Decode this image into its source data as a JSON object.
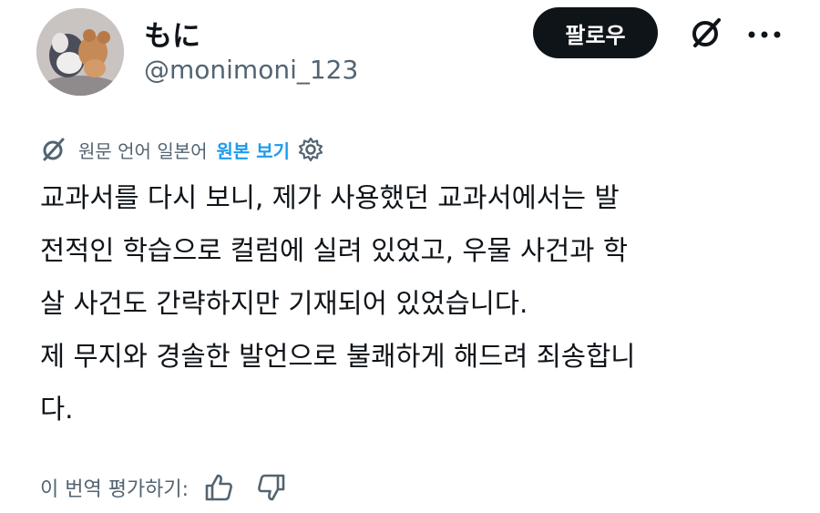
{
  "user": {
    "display_name": "もに",
    "handle": "@monimoni_123"
  },
  "actions": {
    "follow_label": "팔로우"
  },
  "translation": {
    "info_label": "원문 언어 일본어",
    "show_original_label": "원본 보기"
  },
  "post": {
    "text": "교과서를 다시 보니, 제가 사용했던 교과서에서는 발\n전적인 학습으로 컬럼에 실려 있었고, 우물 사건과 학\n살 사건도 간략하지만 기재되어 있었습니다.\n제 무지와 경솔한 발언으로 불쾌하게 해드려 죄송합니\n다."
  },
  "rating": {
    "label": "이 번역 평가하기:"
  },
  "icons": [
    "avatar",
    "grok-icon",
    "more-icon",
    "translate-icon",
    "settings-icon",
    "thumbs-up-icon",
    "thumbs-down-icon"
  ],
  "colors": {
    "text": "#0f1419",
    "secondary": "#536471",
    "link": "#1d9bf0",
    "button": "#0f1419"
  }
}
